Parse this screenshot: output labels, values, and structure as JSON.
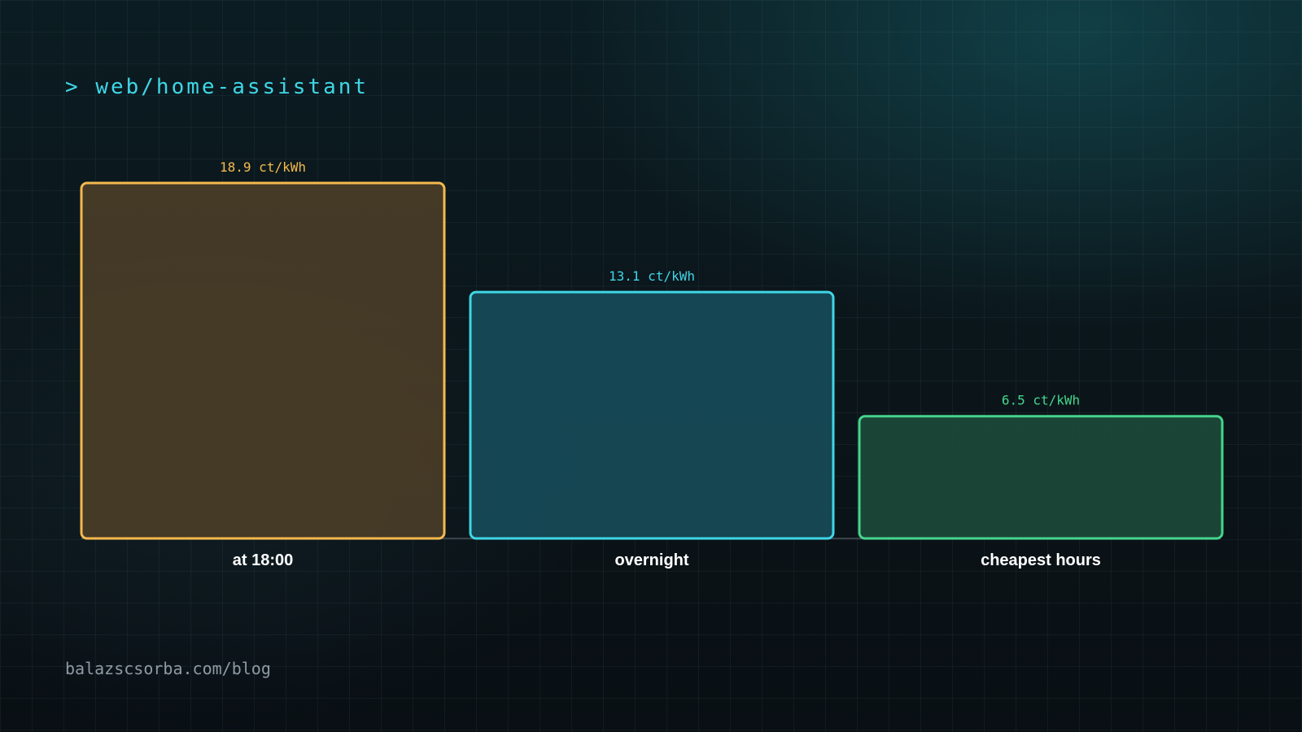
{
  "header": {
    "prompt": ">",
    "path": "web/home-assistant"
  },
  "footer": {
    "url": "balazscsorba.com/blog"
  },
  "chart_data": {
    "type": "bar",
    "categories": [
      "at 18:00",
      "overnight",
      "cheapest hours"
    ],
    "values": [
      18.9,
      13.1,
      6.5
    ],
    "value_labels": [
      "18.9 ct/kWh",
      "13.1 ct/kWh",
      "6.5 ct/kWh"
    ],
    "unit": "ct/kWh",
    "colors": [
      "#f5b94e",
      "#3fd6e6",
      "#45d68c"
    ],
    "fills": [
      "#4a3d27",
      "#174b58",
      "#1c4a3a"
    ],
    "label_color": "#ffffff",
    "baseline_color": "#3a4248",
    "ylim": [
      0,
      18.9
    ],
    "grid": false,
    "legend": "none"
  }
}
